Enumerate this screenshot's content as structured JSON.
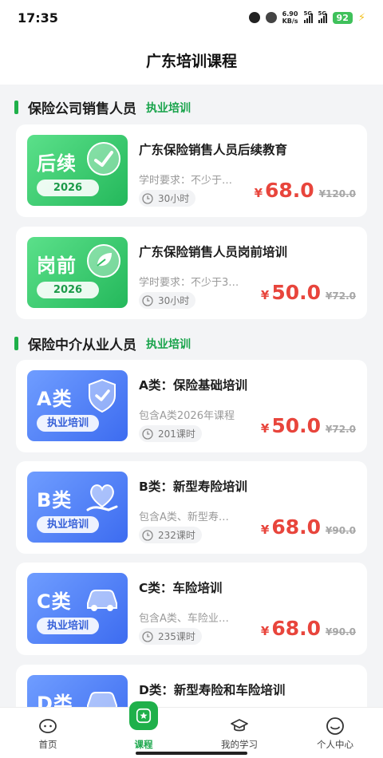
{
  "status_bar": {
    "time": "17:35",
    "speed_top": "6.90",
    "speed_bottom": "KB/s",
    "sig1": "5G",
    "sig2": "5G",
    "battery": "92"
  },
  "header": {
    "title": "广东培训课程"
  },
  "sections": [
    {
      "title": "保险公司销售人员",
      "tag": "执业培训"
    },
    {
      "title": "保险中介从业人员",
      "tag": "执业培训"
    }
  ],
  "courses": [
    {
      "thumb_title": "后续",
      "thumb_pill": "2026",
      "title": "广东保险销售人员后续教育",
      "desc": "学时要求：不少于…",
      "hours": "30小时",
      "currency": "¥",
      "price": "68.0",
      "old_price": "¥120.0"
    },
    {
      "thumb_title": "岗前",
      "thumb_pill": "2026",
      "title": "广东保险销售人员岗前培训",
      "desc": "学时要求：不少于3…",
      "hours": "30小时",
      "currency": "¥",
      "price": "50.0",
      "old_price": "¥72.0"
    },
    {
      "thumb_title": "A类",
      "thumb_pill": "执业培训",
      "title": "A类：保险基础培训",
      "desc": "包含A类2026年课程",
      "hours": "201课时",
      "currency": "¥",
      "price": "50.0",
      "old_price": "¥72.0"
    },
    {
      "thumb_title": "B类",
      "thumb_pill": "执业培训",
      "title": "B类：新型寿险培训",
      "desc": "包含A类、新型寿…",
      "hours": "232课时",
      "currency": "¥",
      "price": "68.0",
      "old_price": "¥90.0"
    },
    {
      "thumb_title": "C类",
      "thumb_pill": "执业培训",
      "title": "C类：车险培训",
      "desc": "包含A类、车险业…",
      "hours": "235课时",
      "currency": "¥",
      "price": "68.0",
      "old_price": "¥90.0"
    },
    {
      "thumb_title": "D类",
      "title": "D类：新型寿险和车险培训"
    }
  ],
  "tabs": [
    {
      "label": "首页",
      "icon": "home-icon"
    },
    {
      "label": "课程",
      "icon": "course-star-icon"
    },
    {
      "label": "我的学习",
      "icon": "graduation-cap-icon"
    },
    {
      "label": "个人中心",
      "icon": "user-icon"
    }
  ],
  "colors": {
    "brand_green": "#1fb04a",
    "price_red": "#e8453c",
    "blue_thumb": "#4a78f2"
  }
}
